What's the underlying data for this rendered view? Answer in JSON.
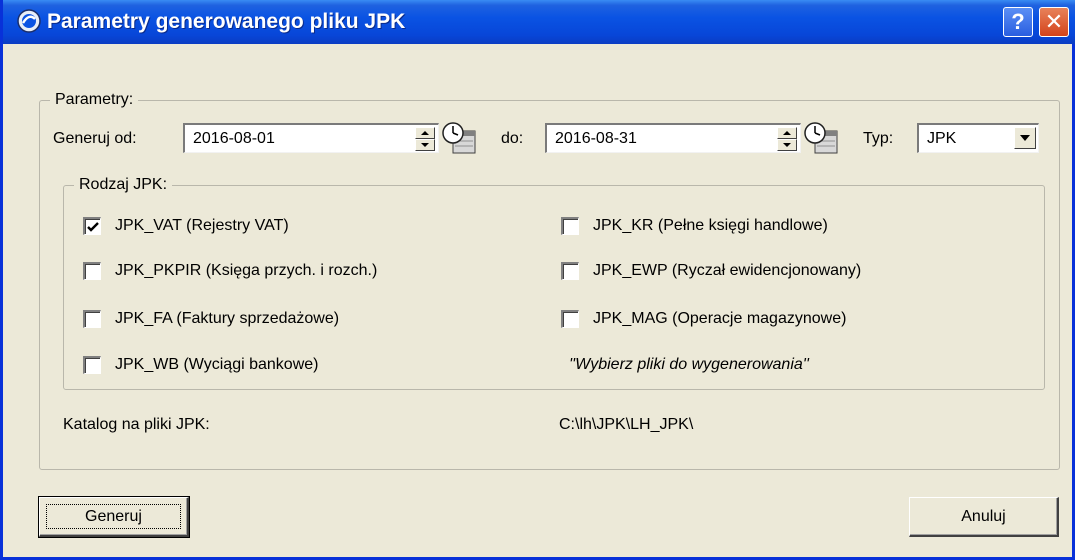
{
  "window": {
    "title": "Parametry generowanego  pliku JPK",
    "help_glyph": "?",
    "close_glyph": "✕"
  },
  "params": {
    "group_label": "Parametry:",
    "from_label": "Generuj od:",
    "from_value": "2016-08-01",
    "to_label": "do:",
    "to_value": "2016-08-31",
    "type_label": "Typ:",
    "type_value": "JPK"
  },
  "jpk": {
    "group_label": "Rodzaj JPK:",
    "items": [
      {
        "label": "JPK_VAT (Rejestry VAT)",
        "checked": true
      },
      {
        "label": "JPK_PKPIR (Księga przych. i rozch.)",
        "checked": false
      },
      {
        "label": "JPK_FA (Faktury sprzedażowe)",
        "checked": false
      },
      {
        "label": "JPK_WB (Wyciągi bankowe)",
        "checked": false
      },
      {
        "label": "JPK_KR (Pełne księgi handlowe)",
        "checked": false
      },
      {
        "label": "JPK_EWP (Ryczał ewidencjonowany)",
        "checked": false
      },
      {
        "label": "JPK_MAG (Operacje magazynowe)",
        "checked": false
      }
    ],
    "hint": "''Wybierz pliki do wygenerowania''"
  },
  "catalog": {
    "label": "Katalog na pliki JPK:",
    "path": "C:\\lh\\JPK\\LH_JPK\\"
  },
  "buttons": {
    "generate": "Generuj",
    "cancel": "Anuluj"
  },
  "icons": {
    "window_icon": "app-circle-icon",
    "calendar": "calendar-clock-icon",
    "checkmark": "checkmark-icon"
  },
  "colors": {
    "titlebar": "#0a53e3",
    "window_bg": "#ece9d8",
    "close": "#d4431b"
  }
}
